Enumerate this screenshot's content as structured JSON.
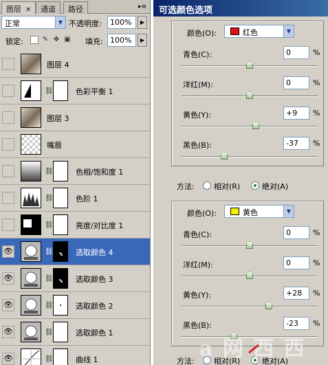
{
  "layers_panel": {
    "tabs": [
      {
        "label": "图层",
        "active": true
      },
      {
        "label": "通道",
        "active": false
      },
      {
        "label": "路径",
        "active": false
      }
    ],
    "blend_mode": "正常",
    "opacity_label": "不透明度:",
    "opacity_value": "100%",
    "lock_label": "锁定:",
    "fill_label": "填充:",
    "fill_value": "100%",
    "layers": [
      {
        "name": "图层 4",
        "visible": false,
        "selected": false,
        "kind": "photo"
      },
      {
        "name": "色彩平衡 1",
        "visible": false,
        "selected": false,
        "kind": "adjust-balance"
      },
      {
        "name": "图层 3",
        "visible": false,
        "selected": false,
        "kind": "photo"
      },
      {
        "name": "嘴唇",
        "visible": false,
        "selected": false,
        "kind": "transparent"
      },
      {
        "name": "色相/饱和度 1",
        "visible": false,
        "selected": false,
        "kind": "adjust-hue"
      },
      {
        "name": "色阶 1",
        "visible": false,
        "selected": false,
        "kind": "adjust-levels"
      },
      {
        "name": "亮度/对比度 1",
        "visible": false,
        "selected": false,
        "kind": "adjust-brightness"
      },
      {
        "name": "选取颜色 4",
        "visible": true,
        "selected": true,
        "kind": "adjust-selective"
      },
      {
        "name": "选取颜色 3",
        "visible": true,
        "selected": false,
        "kind": "adjust-selective"
      },
      {
        "name": "选取颜色 2",
        "visible": true,
        "selected": false,
        "kind": "adjust-selective"
      },
      {
        "name": "选取颜色 1",
        "visible": true,
        "selected": false,
        "kind": "adjust-selective"
      },
      {
        "name": "曲线 1",
        "visible": true,
        "selected": false,
        "kind": "adjust-curves"
      }
    ]
  },
  "dialog": {
    "title": "可选颜色选项",
    "color_label": "颜色(O):",
    "percent": "%",
    "method_label": "方法:",
    "relative_label": "相对(R)",
    "absolute_label": "绝对(A)",
    "sections": [
      {
        "color_name": "红色",
        "swatch": "#e01010",
        "sliders": [
          {
            "label": "青色(C):",
            "value": "0",
            "pos": 0.5
          },
          {
            "label": "洋红(M):",
            "value": "0",
            "pos": 0.5
          },
          {
            "label": "黄色(Y):",
            "value": "+9",
            "pos": 0.545
          },
          {
            "label": "黑色(B):",
            "value": "-37",
            "pos": 0.315
          }
        ],
        "method": "absolute"
      },
      {
        "color_name": "黄色",
        "swatch": "#f0f000",
        "sliders": [
          {
            "label": "青色(C):",
            "value": "0",
            "pos": 0.5
          },
          {
            "label": "洋红(M):",
            "value": "0",
            "pos": 0.5
          },
          {
            "label": "黄色(Y):",
            "value": "+28",
            "pos": 0.64
          },
          {
            "label": "黑色(B):",
            "value": "-23",
            "pos": 0.385
          }
        ],
        "method": "absolute"
      }
    ]
  }
}
